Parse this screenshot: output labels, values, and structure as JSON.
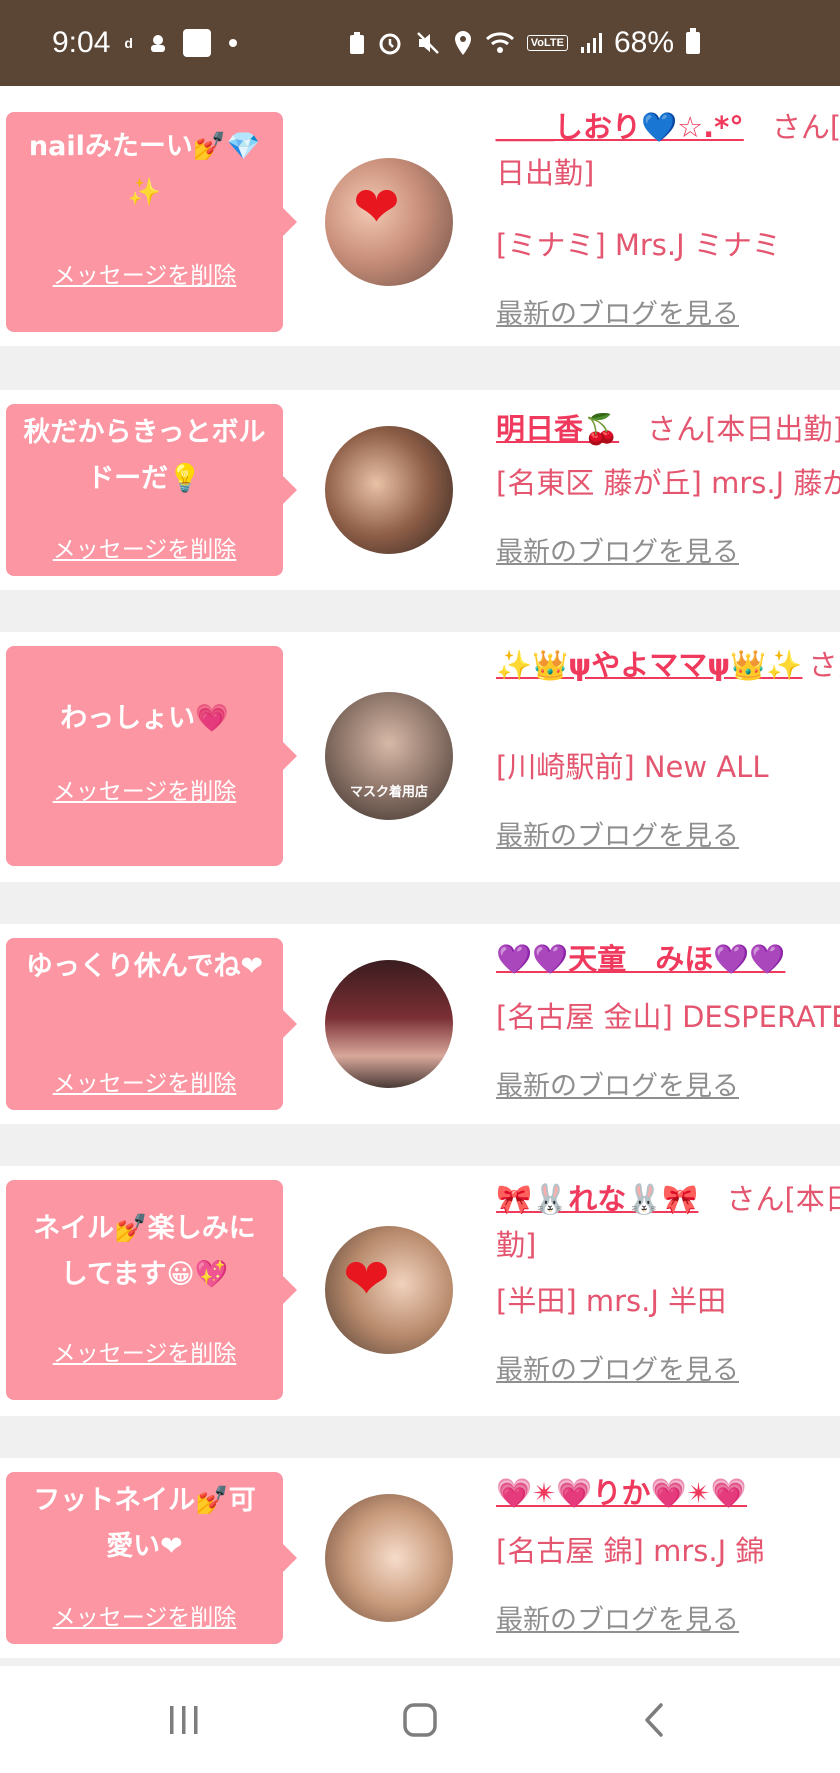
{
  "status_bar": {
    "time": "9:04",
    "battery": "68%",
    "icons": [
      "docomo-icon",
      "app-icon",
      "koromoya-badge-icon",
      "recycle-icon",
      "alarm-icon",
      "mute-icon",
      "location-icon",
      "wifi-icon",
      "volte-icon",
      "signal-icon",
      "battery-icon"
    ],
    "volte_label": "VoLTE"
  },
  "messages": [
    {
      "message": "nailみたーい💅💎✨",
      "delete_label": "メッセージを削除",
      "name_prefix": "＿＿",
      "name": "しおり💙☆.*°",
      "name_suffix": "さん[本日出勤]",
      "shop": "[ミナミ] Mrs.J ミナミ",
      "blog_label": "最新のブログを見る"
    },
    {
      "message": "秋だからきっとボルドーだ💡",
      "delete_label": "メッセージを削除",
      "name_prefix": "",
      "name": "明日香🍒",
      "name_suffix": "さん[本日出勤]",
      "shop": "[名東区 藤が丘] mrs.J 藤が丘",
      "blog_label": "最新のブログを見る"
    },
    {
      "message": "わっしょい💗",
      "delete_label": "メッセージを削除",
      "name_prefix": "",
      "name": "✨👑ψやよママψ👑✨",
      "name_suffix": "さん",
      "shop": "[川崎駅前] New ALL",
      "blog_label": "最新のブログを見る"
    },
    {
      "message": "ゆっくり休んでね❤",
      "delete_label": "メッセージを削除",
      "name_prefix": "",
      "name": "💜💜天童　みほ💜💜",
      "name_suffix": "",
      "shop": "[名古屋 金山] DESPERATE",
      "blog_label": "最新のブログを見る"
    },
    {
      "message": "ネイル💅楽しみにしてます😀💖",
      "delete_label": "メッセージを削除",
      "name_prefix": "",
      "name": "🎀🐰れな🐰🎀",
      "name_suffix": "さん[本日出勤]",
      "shop": "[半田] mrs.J 半田",
      "blog_label": "最新のブログを見る"
    },
    {
      "message": "フットネイル💅可愛い❤",
      "delete_label": "メッセージを削除",
      "name_prefix": "",
      "name": "💗✴💗りか💗✴💗",
      "name_suffix": "",
      "shop": "[名古屋 錦] mrs.J 錦",
      "blog_label": "最新のブログを見る"
    }
  ],
  "avatar_caption": "マスク着用店",
  "nav_bar": {
    "recent_icon": "recent-apps-icon",
    "home_icon": "home-icon",
    "back_icon": "back-icon"
  },
  "colors": {
    "status_bar": "#5b4636",
    "bubble": "#fb96a2",
    "name": "#ef3a5d",
    "shop": "#e4566f",
    "blog": "#8f8f8f"
  }
}
